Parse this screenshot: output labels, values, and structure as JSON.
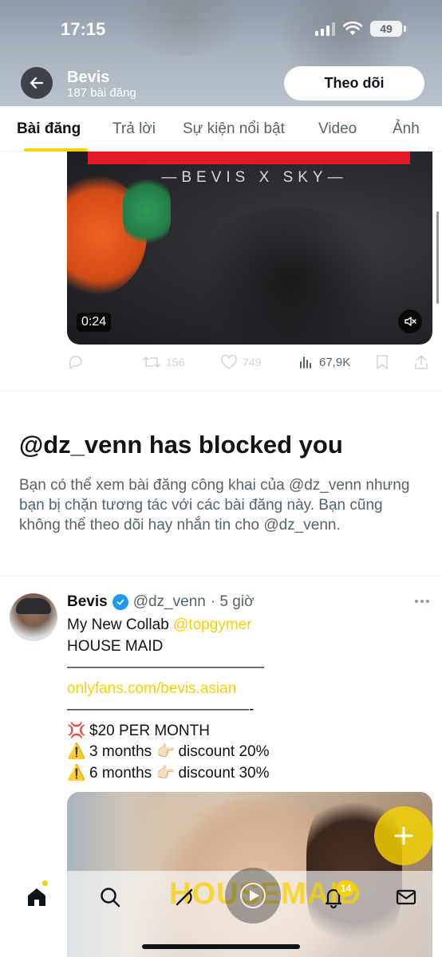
{
  "status_bar": {
    "time": "17:15",
    "battery": "49"
  },
  "header": {
    "profile_name": "Bevis",
    "post_count": "187 bài đăng",
    "follow_label": "Theo dõi"
  },
  "tabs": [
    {
      "label": "Bài đăng",
      "active": true
    },
    {
      "label": "Trả lời",
      "active": false
    },
    {
      "label": "Sự kiện nổi bật",
      "active": false
    },
    {
      "label": "Video",
      "active": false
    },
    {
      "label": "Ảnh",
      "active": false
    }
  ],
  "post1": {
    "video_title": "—BEVIS X SKY—",
    "duration": "0:24",
    "retweets": "156",
    "likes": "749",
    "views": "67,9K"
  },
  "blocked": {
    "title": "@dz_venn has blocked you",
    "description": "Bạn có thể xem bài đăng công khai của @dz_venn nhưng bạn bị chặn tương tác với các bài đăng này. Bạn cũng không thể theo dõi hay nhắn tin cho @dz_venn."
  },
  "post2": {
    "author": "Bevis",
    "handle": "@dz_venn",
    "time": "· 5 giờ",
    "line1_text": "My New Collab ",
    "line1_mention": "@topgymer",
    "line2": "HOUSE MAID",
    "line3": "—————————————",
    "link": "onlyfans.com/bevis.asian",
    "line5": "————————————-",
    "price_emoji": "💢",
    "price": "$20 PER MONTH",
    "warn_emoji": "⚠️",
    "point_emoji": "👉🏻",
    "offer1_a": "3 months",
    "offer1_b": "discount 20%",
    "offer2_a": "6 months",
    "offer2_b": "discount 30%"
  },
  "watermark": "HOUSEMAID",
  "bottom_nav": {
    "notification_count": "14"
  },
  "colors": {
    "accent": "#f5d200",
    "text_primary": "#0f1419",
    "text_secondary": "#536471",
    "verified": "#1d9bf0"
  }
}
